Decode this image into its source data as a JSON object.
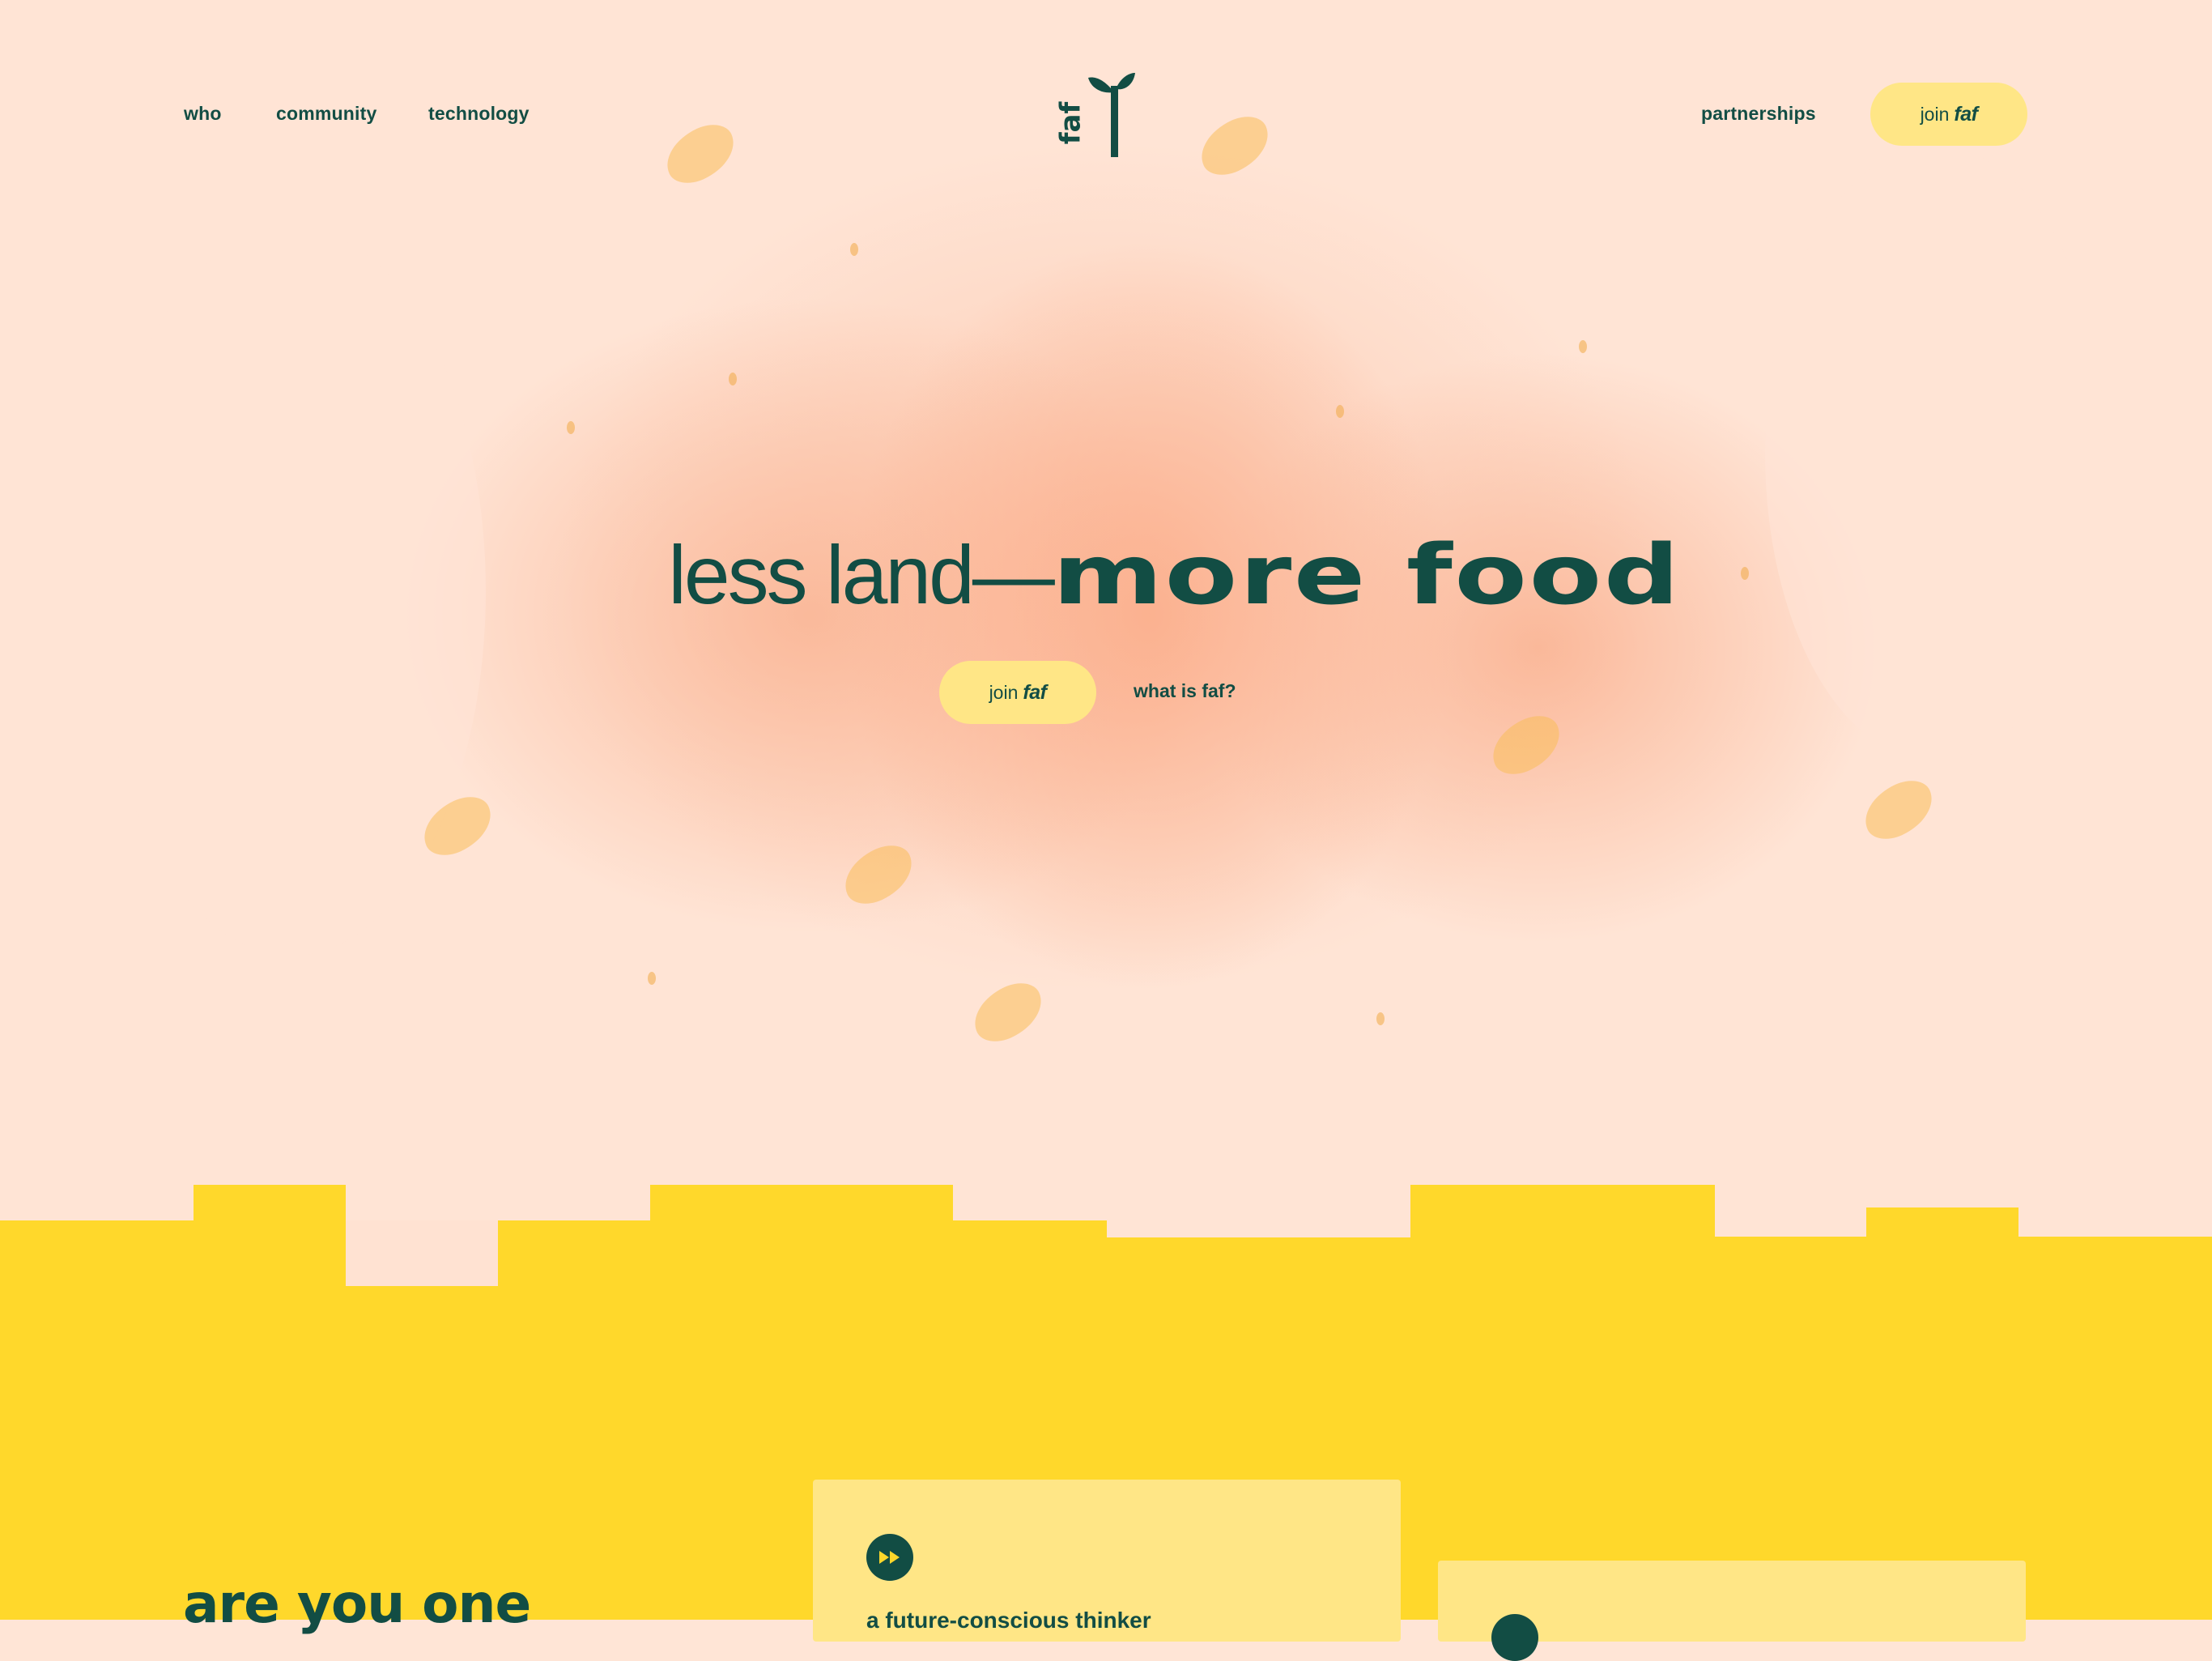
{
  "colors": {
    "brand_green": "#124d44",
    "pill_yellow": "#ffe686",
    "section_yellow": "#ffd82b",
    "hero_bg": "#ffe5d6"
  },
  "nav": {
    "left_links": [
      "who",
      "community",
      "technology"
    ],
    "logo_text": "faf",
    "right_link": "partnerships",
    "cta": {
      "prefix": "join",
      "brand": "faf"
    }
  },
  "hero": {
    "headline_light": "less land—",
    "headline_bold": "more food",
    "cta": {
      "prefix": "join",
      "brand": "faf"
    },
    "secondary_link": "what is faf?"
  },
  "section": {
    "title": "are you one",
    "card1": {
      "icon": "fast-forward-icon",
      "text": "a future-conscious thinker"
    },
    "card2": {
      "icon": "circle-icon"
    }
  }
}
